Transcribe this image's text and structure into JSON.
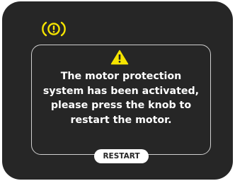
{
  "status": {
    "icon": "brake-warning-icon",
    "color": "#f5e400"
  },
  "dialog": {
    "icon": "warning-triangle-icon",
    "icon_color": "#f5e400",
    "message": "The motor protection\nsystem has been activated,\nplease press the knob to\nrestart the motor.",
    "button_label": "RESTART"
  },
  "theme": {
    "background": "#262626",
    "text": "#ffffff",
    "border": "#d0d0d0"
  }
}
